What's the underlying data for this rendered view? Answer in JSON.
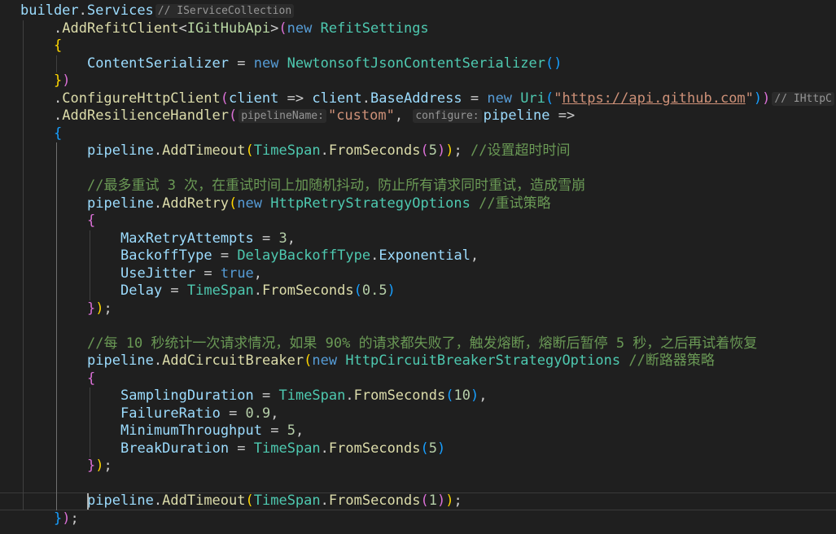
{
  "editor": {
    "language": "C#",
    "theme": {
      "background": "#1f1f1f",
      "variable": "#9cdcfe",
      "type": "#4ec9b0",
      "method": "#dcdcaa",
      "keyword": "#569cd6",
      "number": "#b5cea8",
      "string": "#ce9178",
      "comment": "#6a9955",
      "bracket_level_1": "#ffd700",
      "bracket_level_2": "#da70d6",
      "bracket_level_3": "#179fff"
    },
    "current_line": 28,
    "lines": [
      {
        "indent": 0,
        "tokens": [
          {
            "t": "builder",
            "c": "r"
          },
          {
            "t": ".",
            "c": "p"
          },
          {
            "t": "Services",
            "c": "r"
          },
          {
            "t": "// IServiceCollection",
            "c": "h"
          }
        ]
      },
      {
        "indent": 1,
        "tokens": [
          {
            "t": ".",
            "c": "p"
          },
          {
            "t": "AddRefitClient",
            "c": "m"
          },
          {
            "t": "<",
            "c": "p"
          },
          {
            "t": "IGitHubApi",
            "c": "i"
          },
          {
            "t": ">",
            "c": "p"
          },
          {
            "t": "(",
            "c": "b2"
          },
          {
            "t": "new ",
            "c": "k"
          },
          {
            "t": "RefitSettings",
            "c": "t"
          }
        ]
      },
      {
        "indent": 1,
        "tokens": [
          {
            "t": "{",
            "c": "b1"
          }
        ]
      },
      {
        "indent": 2,
        "tokens": [
          {
            "t": "ContentSerializer",
            "c": "r"
          },
          {
            "t": " = ",
            "c": "p"
          },
          {
            "t": "new ",
            "c": "k"
          },
          {
            "t": "NewtonsoftJsonContentSerializer",
            "c": "t"
          },
          {
            "t": "()",
            "c": "b3"
          }
        ]
      },
      {
        "indent": 1,
        "tokens": [
          {
            "t": "}",
            "c": "b1"
          },
          {
            "t": ")",
            "c": "b2"
          }
        ]
      },
      {
        "indent": 1,
        "tokens": [
          {
            "t": ".",
            "c": "p"
          },
          {
            "t": "ConfigureHttpClient",
            "c": "m"
          },
          {
            "t": "(",
            "c": "b2"
          },
          {
            "t": "client",
            "c": "r"
          },
          {
            "t": " => ",
            "c": "p"
          },
          {
            "t": "client",
            "c": "r"
          },
          {
            "t": ".",
            "c": "p"
          },
          {
            "t": "BaseAddress",
            "c": "r"
          },
          {
            "t": " = ",
            "c": "p"
          },
          {
            "t": "new ",
            "c": "k"
          },
          {
            "t": "Uri",
            "c": "t"
          },
          {
            "t": "(",
            "c": "b3"
          },
          {
            "t": "\"",
            "c": "s"
          },
          {
            "t": "https://api.github.com",
            "c": "u"
          },
          {
            "t": "\"",
            "c": "s"
          },
          {
            "t": ")",
            "c": "b3"
          },
          {
            "t": ")",
            "c": "b2"
          },
          {
            "t": "// IHttpC",
            "c": "h"
          }
        ]
      },
      {
        "indent": 1,
        "tokens": [
          {
            "t": ".",
            "c": "p"
          },
          {
            "t": "AddResilienceHandler",
            "c": "m"
          },
          {
            "t": "(",
            "c": "b2"
          },
          {
            "t": "pipelineName:",
            "c": "h"
          },
          {
            "t": "\"custom\"",
            "c": "s"
          },
          {
            "t": ", ",
            "c": "p"
          },
          {
            "t": "configure:",
            "c": "h"
          },
          {
            "t": "pipeline",
            "c": "r"
          },
          {
            "t": " =>",
            "c": "p"
          }
        ]
      },
      {
        "indent": 1,
        "tokens": [
          {
            "t": "{",
            "c": "b3"
          }
        ]
      },
      {
        "indent": 2,
        "tokens": [
          {
            "t": "pipeline",
            "c": "r"
          },
          {
            "t": ".",
            "c": "p"
          },
          {
            "t": "AddTimeout",
            "c": "m"
          },
          {
            "t": "(",
            "c": "b1"
          },
          {
            "t": "TimeSpan",
            "c": "t"
          },
          {
            "t": ".",
            "c": "p"
          },
          {
            "t": "FromSeconds",
            "c": "m"
          },
          {
            "t": "(",
            "c": "b2"
          },
          {
            "t": "5",
            "c": "n"
          },
          {
            "t": ")",
            "c": "b2"
          },
          {
            "t": ")",
            "c": "b1"
          },
          {
            "t": "; ",
            "c": "p"
          },
          {
            "t": "//设置超时时间",
            "c": "c"
          }
        ]
      },
      {
        "indent": 0,
        "tokens": []
      },
      {
        "indent": 2,
        "tokens": [
          {
            "t": "//最多重试 3 次，在重试时间上加随机抖动，防止所有请求同时重试，造成雪崩",
            "c": "c"
          }
        ]
      },
      {
        "indent": 2,
        "tokens": [
          {
            "t": "pipeline",
            "c": "r"
          },
          {
            "t": ".",
            "c": "p"
          },
          {
            "t": "AddRetry",
            "c": "m"
          },
          {
            "t": "(",
            "c": "b1"
          },
          {
            "t": "new ",
            "c": "k"
          },
          {
            "t": "HttpRetryStrategyOptions",
            "c": "t"
          },
          {
            "t": " ",
            "c": "p"
          },
          {
            "t": "//重试策略",
            "c": "c"
          }
        ]
      },
      {
        "indent": 2,
        "tokens": [
          {
            "t": "{",
            "c": "b2"
          }
        ]
      },
      {
        "indent": 3,
        "tokens": [
          {
            "t": "MaxRetryAttempts",
            "c": "r"
          },
          {
            "t": " = ",
            "c": "p"
          },
          {
            "t": "3",
            "c": "n"
          },
          {
            "t": ",",
            "c": "p"
          }
        ]
      },
      {
        "indent": 3,
        "tokens": [
          {
            "t": "BackoffType",
            "c": "r"
          },
          {
            "t": " = ",
            "c": "p"
          },
          {
            "t": "DelayBackoffType",
            "c": "t"
          },
          {
            "t": ".",
            "c": "p"
          },
          {
            "t": "Exponential",
            "c": "r"
          },
          {
            "t": ",",
            "c": "p"
          }
        ]
      },
      {
        "indent": 3,
        "tokens": [
          {
            "t": "UseJitter",
            "c": "r"
          },
          {
            "t": " = ",
            "c": "p"
          },
          {
            "t": "true",
            "c": "k"
          },
          {
            "t": ",",
            "c": "p"
          }
        ]
      },
      {
        "indent": 3,
        "tokens": [
          {
            "t": "Delay",
            "c": "r"
          },
          {
            "t": " = ",
            "c": "p"
          },
          {
            "t": "TimeSpan",
            "c": "t"
          },
          {
            "t": ".",
            "c": "p"
          },
          {
            "t": "FromSeconds",
            "c": "m"
          },
          {
            "t": "(",
            "c": "b3"
          },
          {
            "t": "0.5",
            "c": "n"
          },
          {
            "t": ")",
            "c": "b3"
          }
        ]
      },
      {
        "indent": 2,
        "tokens": [
          {
            "t": "}",
            "c": "b2"
          },
          {
            "t": ")",
            "c": "b1"
          },
          {
            "t": ";",
            "c": "p"
          }
        ]
      },
      {
        "indent": 0,
        "tokens": []
      },
      {
        "indent": 2,
        "tokens": [
          {
            "t": "//每 10 秒统计一次请求情况，如果 90% 的请求都失败了，触发熔断，熔断后暂停 5 秒，之后再试着恢复",
            "c": "c"
          }
        ]
      },
      {
        "indent": 2,
        "tokens": [
          {
            "t": "pipeline",
            "c": "r"
          },
          {
            "t": ".",
            "c": "p"
          },
          {
            "t": "AddCircuitBreaker",
            "c": "m"
          },
          {
            "t": "(",
            "c": "b1"
          },
          {
            "t": "new ",
            "c": "k"
          },
          {
            "t": "HttpCircuitBreakerStrategyOptions",
            "c": "t"
          },
          {
            "t": " ",
            "c": "p"
          },
          {
            "t": "//断路器策略",
            "c": "c"
          }
        ]
      },
      {
        "indent": 2,
        "tokens": [
          {
            "t": "{",
            "c": "b2"
          }
        ]
      },
      {
        "indent": 3,
        "tokens": [
          {
            "t": "SamplingDuration",
            "c": "r"
          },
          {
            "t": " = ",
            "c": "p"
          },
          {
            "t": "TimeSpan",
            "c": "t"
          },
          {
            "t": ".",
            "c": "p"
          },
          {
            "t": "FromSeconds",
            "c": "m"
          },
          {
            "t": "(",
            "c": "b3"
          },
          {
            "t": "10",
            "c": "n"
          },
          {
            "t": ")",
            "c": "b3"
          },
          {
            "t": ",",
            "c": "p"
          }
        ]
      },
      {
        "indent": 3,
        "tokens": [
          {
            "t": "FailureRatio",
            "c": "r"
          },
          {
            "t": " = ",
            "c": "p"
          },
          {
            "t": "0.9",
            "c": "n"
          },
          {
            "t": ",",
            "c": "p"
          }
        ]
      },
      {
        "indent": 3,
        "tokens": [
          {
            "t": "MinimumThroughput",
            "c": "r"
          },
          {
            "t": " = ",
            "c": "p"
          },
          {
            "t": "5",
            "c": "n"
          },
          {
            "t": ",",
            "c": "p"
          }
        ]
      },
      {
        "indent": 3,
        "tokens": [
          {
            "t": "BreakDuration",
            "c": "r"
          },
          {
            "t": " = ",
            "c": "p"
          },
          {
            "t": "TimeSpan",
            "c": "t"
          },
          {
            "t": ".",
            "c": "p"
          },
          {
            "t": "FromSeconds",
            "c": "m"
          },
          {
            "t": "(",
            "c": "b3"
          },
          {
            "t": "5",
            "c": "n"
          },
          {
            "t": ")",
            "c": "b3"
          }
        ]
      },
      {
        "indent": 2,
        "tokens": [
          {
            "t": "}",
            "c": "b2"
          },
          {
            "t": ")",
            "c": "b1"
          },
          {
            "t": ";",
            "c": "p"
          }
        ]
      },
      {
        "indent": 0,
        "tokens": []
      },
      {
        "indent": 2,
        "tokens": [
          {
            "t": "pipeline",
            "c": "r"
          },
          {
            "t": ".",
            "c": "p"
          },
          {
            "t": "AddTimeout",
            "c": "m"
          },
          {
            "t": "(",
            "c": "b1"
          },
          {
            "t": "TimeSpan",
            "c": "t"
          },
          {
            "t": ".",
            "c": "p"
          },
          {
            "t": "FromSeconds",
            "c": "m"
          },
          {
            "t": "(",
            "c": "b2"
          },
          {
            "t": "1",
            "c": "n"
          },
          {
            "t": ")",
            "c": "b2"
          },
          {
            "t": ")",
            "c": "b1"
          },
          {
            "t": ";",
            "c": "p"
          }
        ]
      },
      {
        "indent": 1,
        "tokens": [
          {
            "t": "}",
            "c": "b3"
          },
          {
            "t": ")",
            "c": "b2"
          },
          {
            "t": ";",
            "c": "p"
          }
        ]
      }
    ]
  }
}
